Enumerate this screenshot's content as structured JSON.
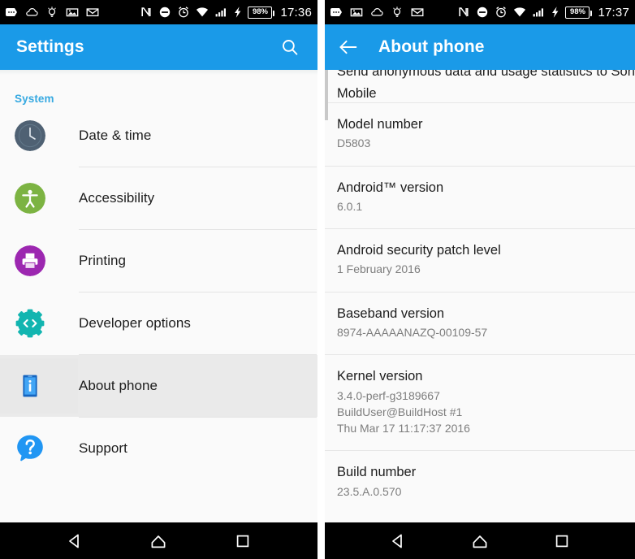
{
  "left_phone": {
    "statusbar": {
      "icons": [
        "message-icon",
        "cloud-icon",
        "lightbulb-idea-icon",
        "screenshot-image-icon",
        "email-icon",
        "nfc-icon",
        "do-not-disturb-icon",
        "alarm-clock-icon",
        "wifi-icon",
        "cellular-signal-icon",
        "charging-bolt-icon",
        "battery-icon"
      ],
      "battery_percent": "98%",
      "clock": "17:36"
    },
    "appbar": {
      "title": "Settings",
      "search_icon": "search-icon"
    },
    "section_label": "System",
    "items": [
      {
        "label": "Date & time",
        "icon": "clock-icon",
        "selected": false
      },
      {
        "label": "Accessibility",
        "icon": "accessibility-icon",
        "selected": false
      },
      {
        "label": "Printing",
        "icon": "printer-icon",
        "selected": false
      },
      {
        "label": "Developer options",
        "icon": "developer-options-icon",
        "selected": false
      },
      {
        "label": "About phone",
        "icon": "about-phone-icon",
        "selected": true
      },
      {
        "label": "Support",
        "icon": "support-help-icon",
        "selected": false
      }
    ],
    "navbar": {
      "back": "back-nav-icon",
      "home": "home-nav-icon",
      "recents": "recents-nav-icon"
    }
  },
  "right_phone": {
    "statusbar": {
      "icons": [
        "message-icon",
        "screenshot-image-icon",
        "cloud-icon",
        "lightbulb-idea-icon",
        "email-icon",
        "nfc-icon",
        "do-not-disturb-icon",
        "alarm-clock-icon",
        "wifi-icon",
        "cellular-signal-icon",
        "charging-bolt-icon",
        "battery-icon"
      ],
      "battery_percent": "98%",
      "clock": "17:37"
    },
    "appbar": {
      "title": "About phone",
      "back_icon": "back-arrow-icon"
    },
    "partial_row": {
      "clipped_text": "Send anonymous data and usage statistics to Sony",
      "visible_text": "Mobile"
    },
    "details": [
      {
        "title": "Model number",
        "value": "D5803"
      },
      {
        "title": "Android™ version",
        "value": "6.0.1"
      },
      {
        "title": "Android security patch level",
        "value": "1 February 2016"
      },
      {
        "title": "Baseband version",
        "value": "8974-AAAAANAZQ-00109-57"
      },
      {
        "title": "Kernel version",
        "value": "3.4.0-perf-g3189667\nBuildUser@BuildHost #1\nThu Mar 17 11:17:37 2016"
      },
      {
        "title": "Build number",
        "value": "23.5.A.0.570"
      }
    ],
    "navbar": {
      "back": "back-nav-icon",
      "home": "home-nav-icon",
      "recents": "recents-nav-icon"
    }
  },
  "colors": {
    "appbar_blue": "#1a9ae8",
    "section_label_blue": "#36a9e1",
    "clock_icon": "#4f6173",
    "accessibility_green": "#7cb342",
    "printing_purple": "#9c27b0",
    "developer_teal": "#12b5b0",
    "about_blue": "#1565c0",
    "support_blue": "#2196f3",
    "selected_row": "#eaeaea"
  }
}
